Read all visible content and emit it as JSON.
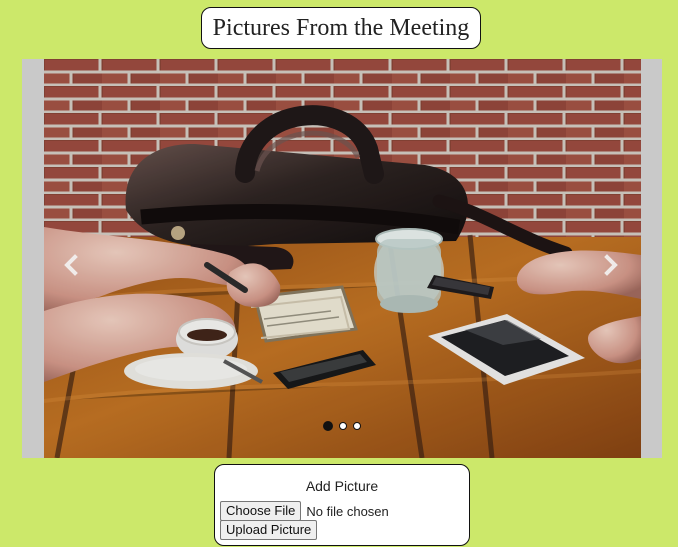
{
  "page": {
    "title": "Pictures From the Meeting"
  },
  "carousel": {
    "active_slide": 1,
    "slide_count": 3,
    "previous_icon": "chevron-left-icon",
    "next_icon": "chevron-right-icon"
  },
  "upload": {
    "title": "Add Picture",
    "choose_file_label": "Choose File",
    "file_status": "No file chosen",
    "upload_label": "Upload Picture"
  },
  "colors": {
    "page_background": "#cce86a",
    "card_background": "#ffffff",
    "carousel_frame": "#c9c9c9"
  }
}
